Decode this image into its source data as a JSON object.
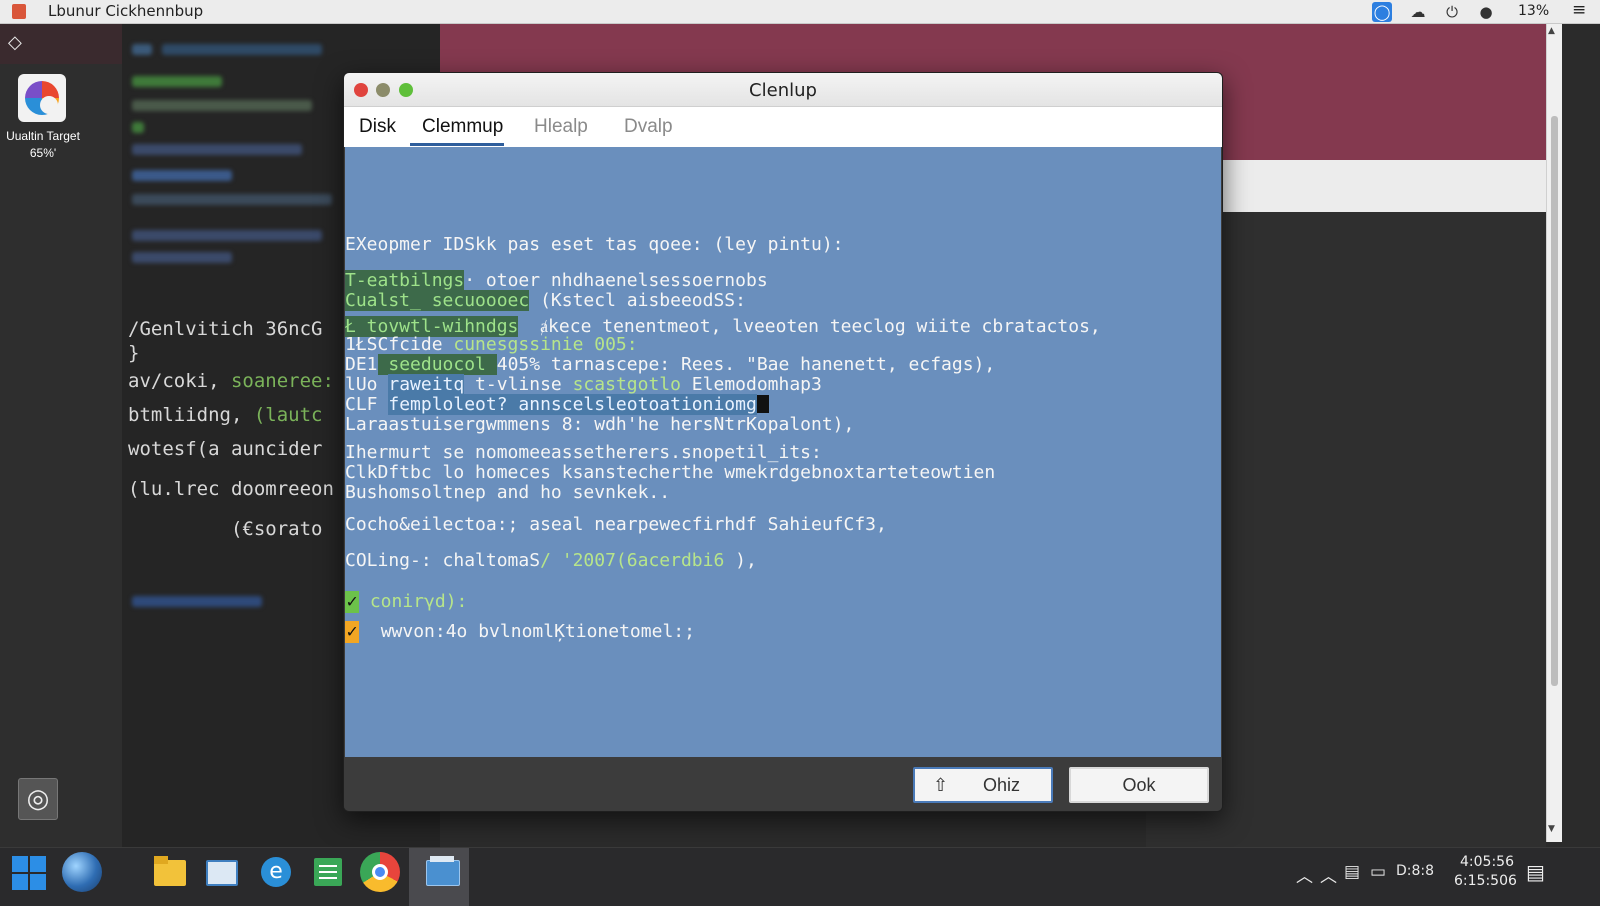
{
  "topbar": {
    "app_icon": "app-icon",
    "title": "Lbunur Cickhennbup",
    "tray_icons": [
      "sync-icon",
      "cloud-icon",
      "power-icon",
      "chrome-icon"
    ],
    "zoom": "13%",
    "menu_icon": "hamburger-icon"
  },
  "launcher": {
    "back_icon": "back-icon",
    "target_label": "Uualtin Target 65%'",
    "camera_icon": "camera-icon"
  },
  "editor": {
    "lines": [
      {
        "a": "/Genlvitich ",
        "b": "36ncG"
      },
      {
        "a": "}",
        "b": ""
      },
      {
        "a": "av/coki, ",
        "b": "soaneree:"
      },
      {
        "a": "btmliidng, ",
        "b": "(lautc"
      },
      {
        "a": "wotesf(a auncider",
        "b": ""
      },
      {
        "a": "(lu.lrec doomreeon",
        "b": ""
      },
      {
        "a": "         (€sorato",
        "b": ""
      }
    ]
  },
  "dialog": {
    "title": "Clenlup",
    "tabs": [
      "Disk",
      "Clemmup",
      "Hlealp",
      "Dvalp"
    ],
    "active_tab": "Clemmup",
    "console": {
      "line1": "EXeopmer IDSkk pas eset tas qoee: (ley pintu):",
      "line2_hl": "T-eatbilngs",
      "line2_rest": "· otoer nhdhaenelsessoernobs",
      "line3_hl": "Cualst_ secuoooec",
      "line3_rest": " (Kstecl aisbeeodSS:",
      "line4_hl": "Ł tovwtl-wihndgs",
      "line4_rest": "  ⱥkece tenentmeot, lveeoten teeclog wiite cbratactos,",
      "line5_a": "1ŁSCfcide ",
      "line5_g": "cunesgssinie 005:",
      "line6_a": "DE1",
      "line6_hl": " seeduocol ",
      "line6_rest": "405% tarnascepe: Rees. \"Bae hanenett, ecfags),",
      "line7_a": "lUo ",
      "line7_hl": "raweitq",
      "line7_rest": " t-vlinse ",
      "line7_g": "scastgotlo",
      "line7_tail": " Elemodomhap3",
      "line8_a": "CLF ",
      "line8_hl": "femploleot? annscelsleotoationiomg",
      "line9": "Laraastuisergwmmens 8: wdh'he hersNtrKopalont),",
      "line10": "Ihermurt se nomomeeassetherers.snopetil_its:",
      "line11": "ClkDftbc lo homeces ksanstecherthe wmekrdgebnoxtarteteowtien",
      "line12": "Bushomsoltnep and ho sevnkek..",
      "line13": "Cocho&eilectoa:; aseal nearpewecfirhdf SahieufCf3,",
      "line14_a": "COLing-: chaltomaS",
      "line14_g": "/ '2007(6acerdbi6",
      "line14_rest": " ),",
      "check1_label": "conirγd):",
      "check2_label": "wwvon:4o bvlnomlĶtionetomel:;"
    },
    "buttons": {
      "ohiz": "Ohiz",
      "ohiz_icon": "share-icon",
      "ook": "Ook"
    }
  },
  "taskbar": {
    "icons": [
      "windows-start-icon",
      "globe-icon",
      "file-explorer-icon",
      "folder-icon",
      "internet-explorer-icon",
      "spreadsheet-icon",
      "chrome-icon",
      "cleanup-app-icon"
    ],
    "tray": [
      "chevron-up-icon",
      "chevron-up-icon",
      "battery-icon",
      "display-icon",
      "D:8:8"
    ],
    "time": "4:05:56",
    "date": "6:15:506",
    "notification_icon": "notification-icon"
  }
}
